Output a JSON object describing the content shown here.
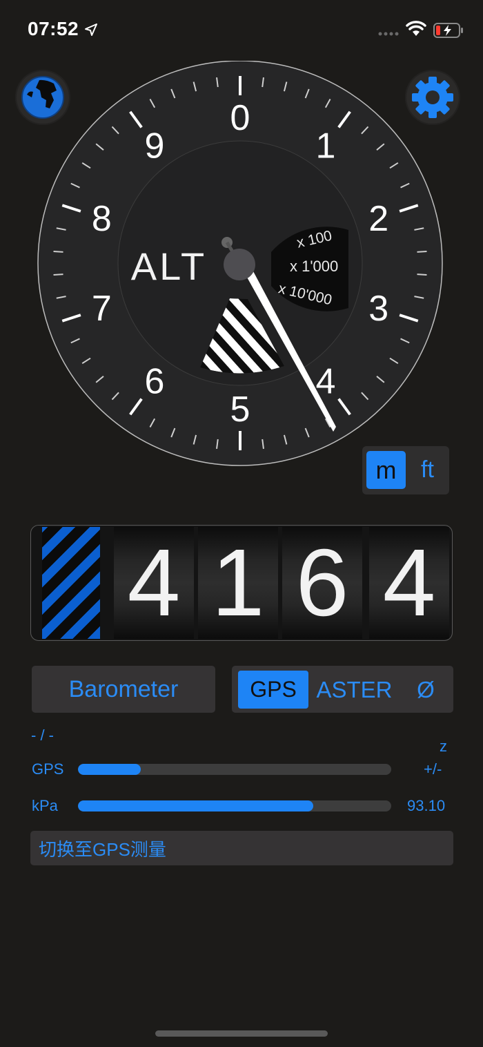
{
  "status_bar": {
    "time": "07:52",
    "battery_color": "#ff3b30"
  },
  "dial": {
    "numerals": [
      "0",
      "1",
      "2",
      "3",
      "4",
      "5",
      "6",
      "7",
      "8",
      "9"
    ],
    "center_label": "ALT",
    "scale_window": {
      "top": "x 100",
      "middle": "x 1'000",
      "bottom": "x 10'000"
    }
  },
  "unit_toggle": {
    "metric": "m",
    "imperial": "ft",
    "selected": "m"
  },
  "odometer": {
    "digits": [
      "4",
      "1",
      "6",
      "4"
    ]
  },
  "source": {
    "barometer_label": "Barometer",
    "options": [
      "GPS",
      "ASTER",
      "Ø"
    ],
    "selected": "GPS"
  },
  "readouts": {
    "dash": "- / -",
    "z": "z",
    "gps_label": "GPS",
    "gps_accuracy": "+/-",
    "gps_level": 0.2,
    "kpa_label": "kPa",
    "kpa_value": "93.10",
    "kpa_level": 0.75
  },
  "switch_message": "切换至GPS测量",
  "colors": {
    "accent": "#1e84f5",
    "background": "#1c1b19",
    "panel": "#353334"
  }
}
